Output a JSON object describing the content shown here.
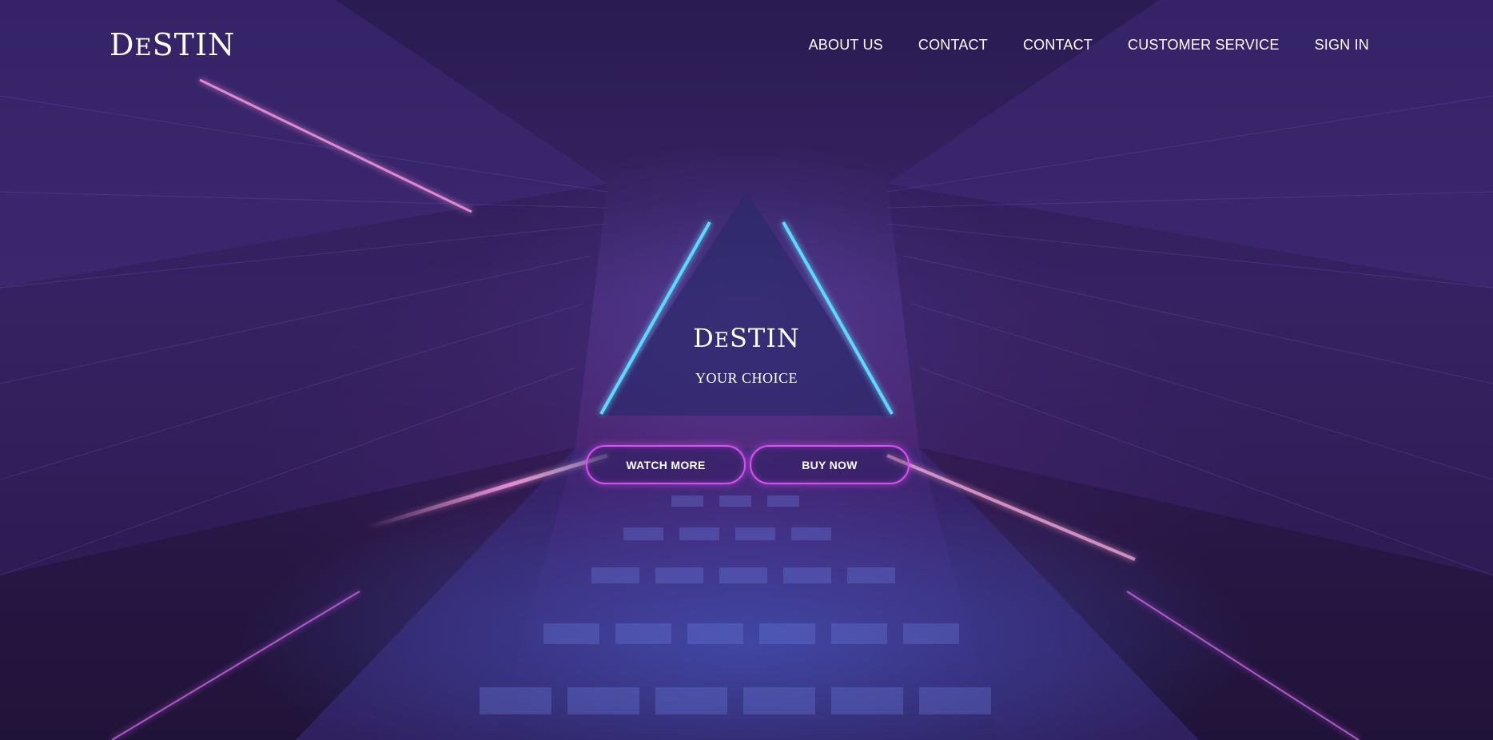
{
  "brand": {
    "logo_first": "D",
    "logo_small": "E",
    "logo_rest": "STIN"
  },
  "nav": {
    "items": [
      {
        "label": "ABOUT US"
      },
      {
        "label": "CONTACT"
      },
      {
        "label": "CONTACT"
      },
      {
        "label": "CUSTOMER SERVICE"
      },
      {
        "label": "SIGN IN"
      }
    ]
  },
  "hero": {
    "title_first": "D",
    "title_small": "E",
    "title_rest": "STIN",
    "tagline": "YOUR CHOICE",
    "watch_more_label": "WATCH MORE",
    "buy_now_label": "BUY NOW"
  },
  "colors": {
    "button_border": "#d94ff0",
    "neon_triangle": "#5fd8ff",
    "background_base": "#2a1b52"
  },
  "icons": {
    "background": "neon-triangle-tunnel-image"
  }
}
